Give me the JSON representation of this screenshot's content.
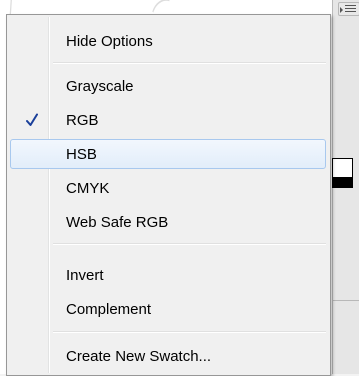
{
  "menu": {
    "items": [
      {
        "label": "Hide Options",
        "checked": false,
        "highlighted": false
      },
      {
        "label": "Grayscale",
        "checked": false,
        "highlighted": false
      },
      {
        "label": "RGB",
        "checked": true,
        "highlighted": false
      },
      {
        "label": "HSB",
        "checked": false,
        "highlighted": true
      },
      {
        "label": "CMYK",
        "checked": false,
        "highlighted": false
      },
      {
        "label": "Web Safe RGB",
        "checked": false,
        "highlighted": false
      },
      {
        "label": "Invert",
        "checked": false,
        "highlighted": false
      },
      {
        "label": "Complement",
        "checked": false,
        "highlighted": false
      },
      {
        "label": "Create New Swatch...",
        "checked": false,
        "highlighted": false
      }
    ]
  },
  "colors": {
    "highlight_border": "#a8c8ee",
    "check_mark": "#1a3f9a",
    "menu_background": "#f0f0f0"
  },
  "icons": {
    "check": "check-icon",
    "panel_menu": "panel-menu-icon"
  }
}
